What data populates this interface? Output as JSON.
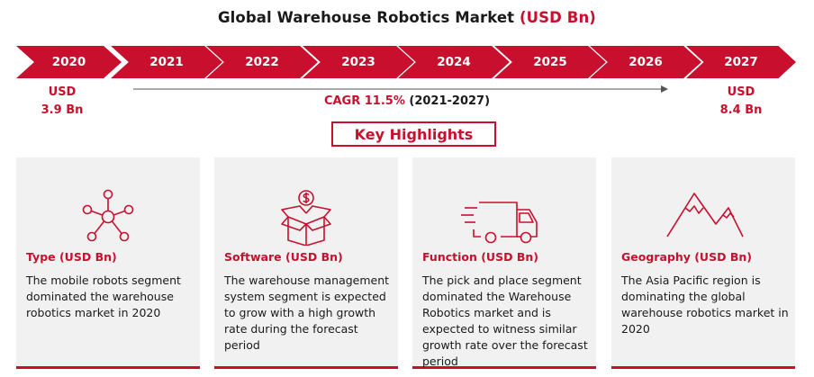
{
  "title": {
    "main": "Global Warehouse Robotics Market",
    "accent": "(USD Bn)"
  },
  "timeline": {
    "years": [
      "2020",
      "2021",
      "2022",
      "2023",
      "2024",
      "2025",
      "2026",
      "2027"
    ]
  },
  "start": {
    "unit": "USD",
    "value": "3.9 Bn"
  },
  "end": {
    "unit": "USD",
    "value": "8.4 Bn"
  },
  "cagr": {
    "label": "CAGR 11.5%",
    "period": "(2021-2027)"
  },
  "key_highlights": "Key Highlights",
  "cards": [
    {
      "title": "Type (USD Bn)",
      "body": "The mobile robots segment dominated the warehouse robotics market in 2020",
      "icon": "network-nodes-icon"
    },
    {
      "title": "Software (USD Bn)",
      "body": "The warehouse management system segment is expected to grow with a high growth rate during the forecast period",
      "icon": "box-dollar-icon"
    },
    {
      "title": "Function (USD Bn)",
      "body": "The pick and place segment dominated the Warehouse Robotics market and is expected to witness similar growth rate over the forecast period",
      "icon": "delivery-truck-icon"
    },
    {
      "title": "Geography (USD Bn)",
      "body": "The Asia Pacific region is dominating the global warehouse robotics market in 2020",
      "icon": "mountains-icon"
    }
  ],
  "colors": {
    "accent": "#c8102e",
    "card_bg": "#f1f1f1"
  },
  "chart_data": {
    "type": "table",
    "title": "Global Warehouse Robotics Market (USD Bn)",
    "categories": [
      "2020",
      "2021",
      "2022",
      "2023",
      "2024",
      "2025",
      "2026",
      "2027"
    ],
    "values": {
      "2020": 3.9,
      "2027": 8.4
    },
    "cagr": "11.5%",
    "cagr_period": "(2021-2027)"
  }
}
